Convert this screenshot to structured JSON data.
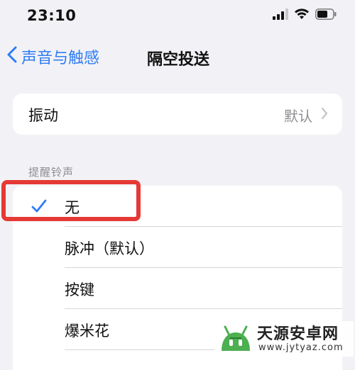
{
  "status_bar": {
    "time": "23:10",
    "icons": [
      "cellular-signal-icon",
      "wifi-icon",
      "battery-icon"
    ]
  },
  "nav": {
    "back_label": "声音与触感",
    "title": "隔空投送"
  },
  "vibration_row": {
    "label": "振动",
    "value": "默认"
  },
  "section": {
    "header": "提醒铃声"
  },
  "tones": [
    {
      "label": "无",
      "selected": true
    },
    {
      "label": "脉冲（默认）",
      "selected": false
    },
    {
      "label": "按键",
      "selected": false
    },
    {
      "label": "爆米花",
      "selected": false
    }
  ],
  "watermark": {
    "title": "天源安卓网",
    "url": "www.jytyaz.com"
  },
  "colors": {
    "accent": "#2f7cf6",
    "highlight": "#e53935",
    "background": "#f2f2f6",
    "secondary_text": "#8e8e93"
  }
}
